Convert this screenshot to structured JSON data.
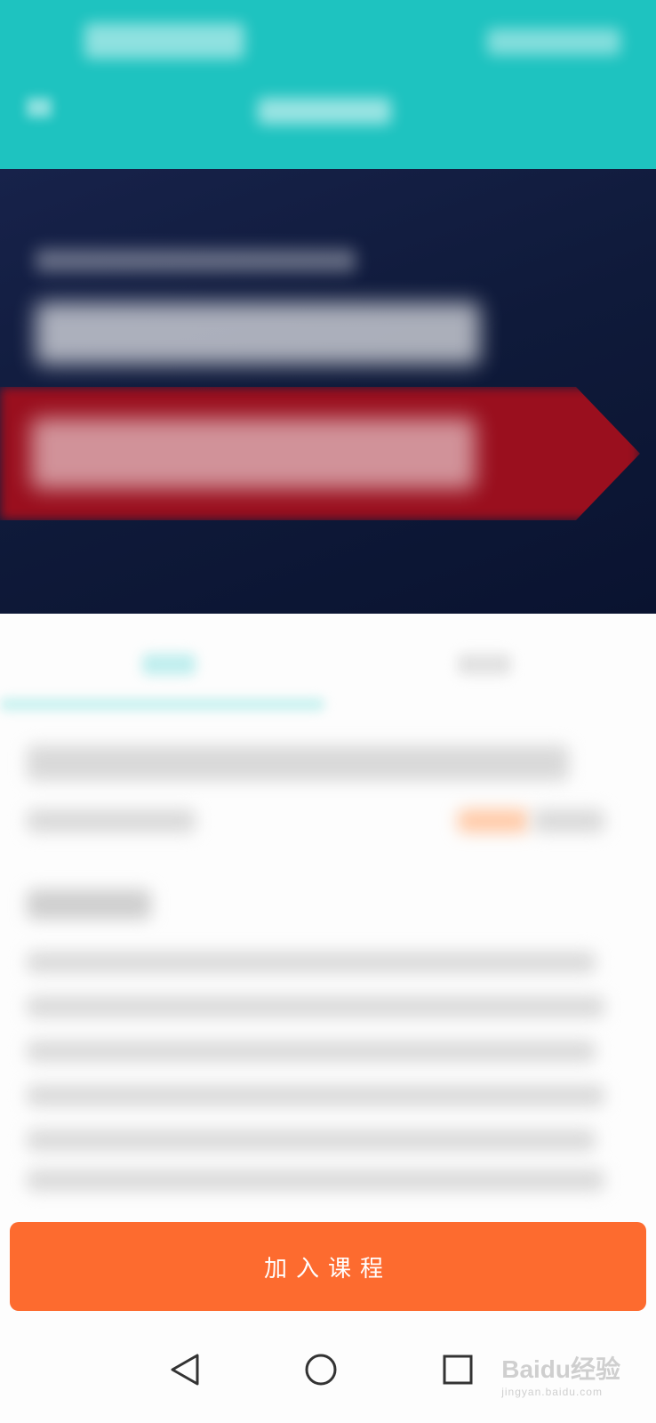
{
  "actions": {
    "join_course_label": "加入课程"
  },
  "watermark": {
    "brand": "Baidu经验",
    "url": "jingyan.baidu.com"
  },
  "colors": {
    "header": "#1ec3c0",
    "banner": "#0f1a3a",
    "ribbon": "#9a0f1e",
    "accent": "#fd6b2f"
  },
  "nav": {
    "back_icon": "triangle-back-icon",
    "home_icon": "circle-home-icon",
    "recent_icon": "square-recent-icon"
  }
}
